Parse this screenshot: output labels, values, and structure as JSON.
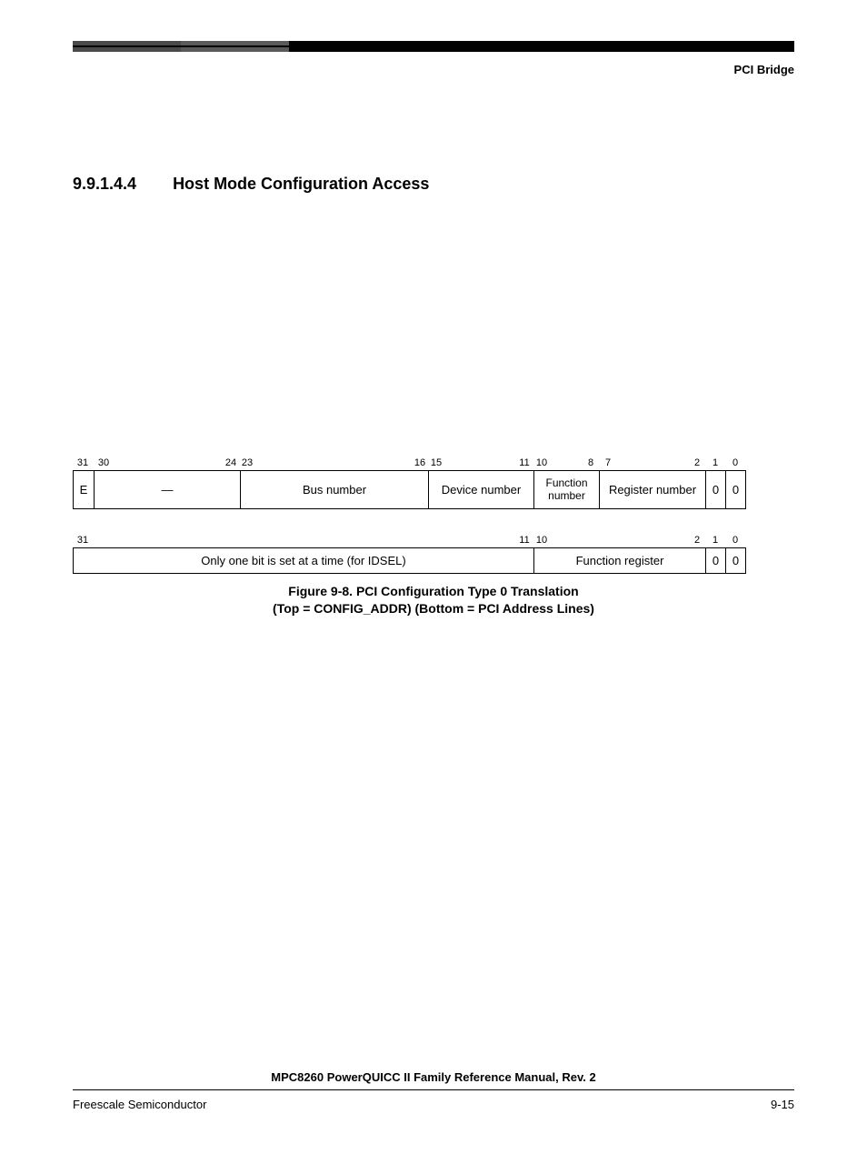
{
  "header": {
    "section_label": "PCI Bridge"
  },
  "section": {
    "number": "9.9.1.4.4",
    "title": "Host Mode Configuration Access"
  },
  "figure8": {
    "top": {
      "bit_labels": [
        "31",
        "30",
        "24",
        "23",
        "16",
        "15",
        "11",
        "10",
        "8",
        "7",
        "2",
        "1",
        "0"
      ],
      "fields": {
        "e": "E",
        "reserved": "—",
        "bus_number": "Bus number",
        "device_number": "Device number",
        "function_number": "Function number",
        "register_number": "Register number",
        "bit1": "0",
        "bit0": "0"
      }
    },
    "bottom": {
      "bit_labels": [
        "31",
        "11",
        "10",
        "2",
        "1",
        "0"
      ],
      "fields": {
        "idsel": "Only one bit is set at a time (for IDSEL)",
        "function_register": "Function register",
        "bit1": "0",
        "bit0": "0"
      }
    },
    "caption_line1": "Figure 9-8. PCI Configuration Type 0 Translation",
    "caption_line2": "(Top = CONFIG_ADDR) (Bottom = PCI Address Lines)"
  },
  "footer": {
    "manual_title": "MPC8260 PowerQUICC II Family Reference Manual, Rev. 2",
    "company": "Freescale Semiconductor",
    "page": "9-15"
  }
}
